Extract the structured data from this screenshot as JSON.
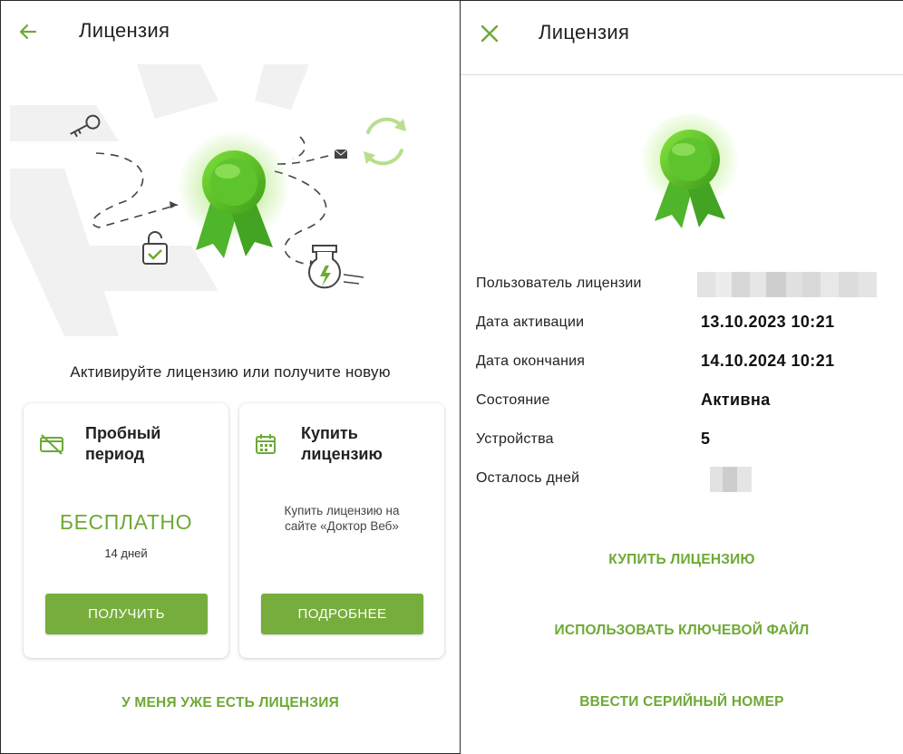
{
  "left": {
    "header": {
      "title": "Лицензия",
      "nav_icon": "arrow-left-icon"
    },
    "subtitle": "Активируйте лицензию или получите новую",
    "trial_card": {
      "title": "Пробный период",
      "price": "БЕСПЛАТНО",
      "duration": "14 дней",
      "button": "ПОЛУЧИТЬ",
      "icon": "no-card-icon"
    },
    "buy_card": {
      "title": "Купить лицензию",
      "description": "Купить лицензию на сайте «Доктор Веб»",
      "button": "ПОДРОБНЕЕ",
      "icon": "calendar-icon"
    },
    "have_license_link": "У МЕНЯ УЖЕ ЕСТЬ ЛИЦЕНЗИЯ"
  },
  "right": {
    "header": {
      "title": "Лицензия",
      "nav_icon": "close-icon"
    },
    "rows": [
      {
        "label": "Пользователь лицензии",
        "value": ""
      },
      {
        "label": "Дата активации",
        "value": "13.10.2023 10:21"
      },
      {
        "label": "Дата окончания",
        "value": "14.10.2024 10:21"
      },
      {
        "label": "Состояние",
        "value": "Активна"
      },
      {
        "label": "Устройства",
        "value": "5"
      },
      {
        "label": "Осталось дней",
        "value": ""
      }
    ],
    "actions": {
      "buy": "КУПИТЬ ЛИЦЕНЗИЮ",
      "key_file": "ИСПОЛЬЗОВАТЬ КЛЮЧЕВОЙ ФАЙЛ",
      "serial": "ВВЕСТИ СЕРИЙНЫЙ НОМЕР"
    }
  },
  "colors": {
    "accent": "#77ad3c",
    "accent_text": "#6ea935",
    "ribbon": "#5fbf2a"
  }
}
